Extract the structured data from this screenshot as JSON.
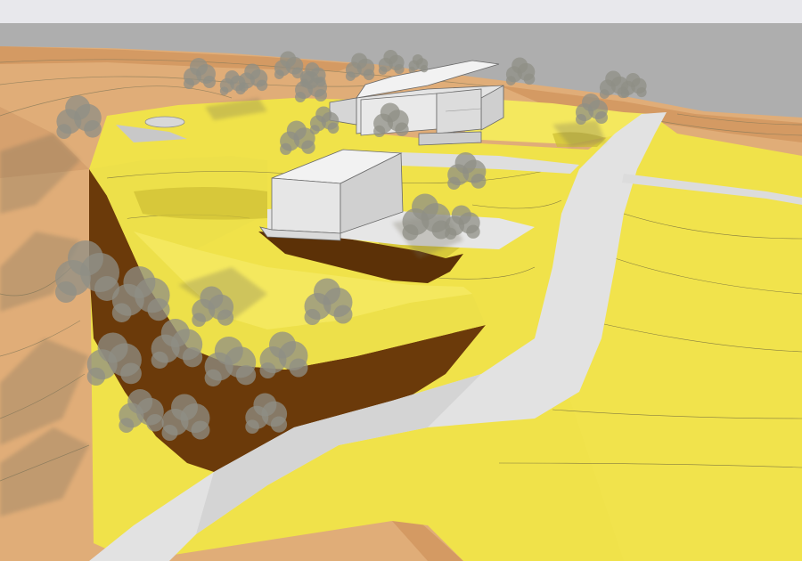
{
  "scene": {
    "kind": "3d-site-model-render",
    "colors": {
      "sky_band": "#e8e8ec",
      "background_gray": "#aeaeae",
      "terrain_tan": "#e0ad78",
      "terrain_tan_dark": "#d49a63",
      "lawn_yellow": "#f0e24a",
      "lawn_yellow_light": "#f4e85e",
      "lawn_shade": "#d9c838",
      "excavation_brown": "#6b3a0a",
      "road_gray": "#e2e2e2",
      "building_white": "#f2f2f2",
      "building_shade": "#cfcfcf",
      "tree_fill": "#8f8f86",
      "shadow": "#7a7a70"
    },
    "elements": [
      "terrain",
      "lawn-platform",
      "excavation-cut",
      "access-road",
      "main-building",
      "annex-building",
      "tree-cluster",
      "pool"
    ]
  }
}
